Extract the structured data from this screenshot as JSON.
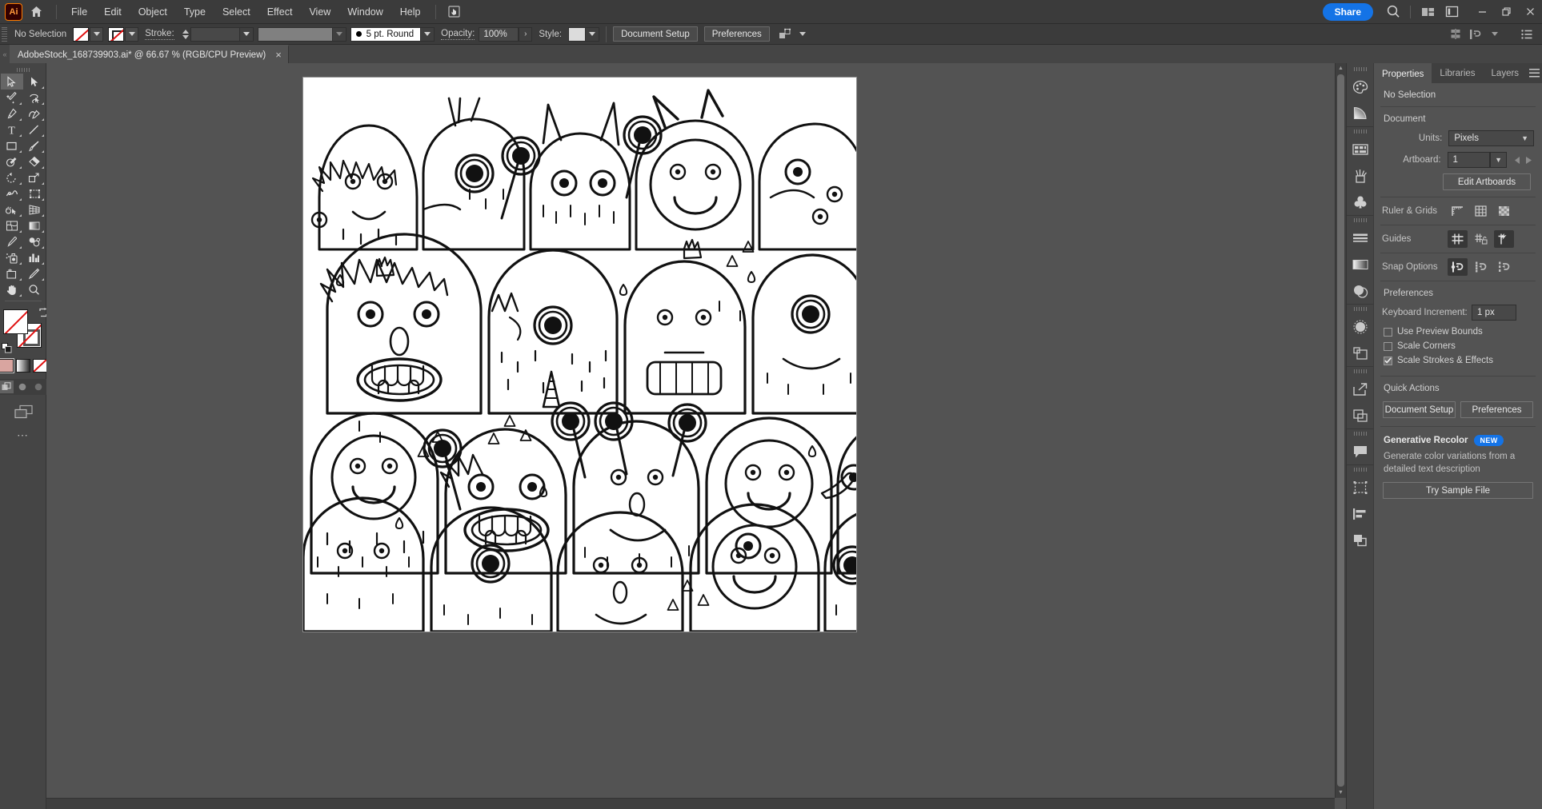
{
  "app": {
    "logo_text": "Ai",
    "menus": [
      "File",
      "Edit",
      "Object",
      "Type",
      "Select",
      "Effect",
      "View",
      "Window",
      "Help"
    ],
    "share_label": "Share"
  },
  "control_bar": {
    "selection_status": "No Selection",
    "stroke_label": "Stroke:",
    "stroke_weight": "",
    "stroke_profile": "5 pt. Round",
    "opacity_label": "Opacity:",
    "opacity_value": "100%",
    "style_label": "Style:",
    "document_setup_label": "Document Setup",
    "preferences_label": "Preferences"
  },
  "tab": {
    "title": "AdobeStock_168739903.ai* @ 66.67 % (RGB/CPU Preview)",
    "close_glyph": "×"
  },
  "tools": [
    {
      "name": "selection-tool"
    },
    {
      "name": "direct-selection-tool"
    },
    {
      "name": "magic-wand-tool"
    },
    {
      "name": "lasso-tool"
    },
    {
      "name": "pen-tool"
    },
    {
      "name": "curvature-tool"
    },
    {
      "name": "type-tool"
    },
    {
      "name": "line-segment-tool"
    },
    {
      "name": "rectangle-tool"
    },
    {
      "name": "paintbrush-tool"
    },
    {
      "name": "shaper-tool"
    },
    {
      "name": "eraser-tool"
    },
    {
      "name": "rotate-tool"
    },
    {
      "name": "scale-tool"
    },
    {
      "name": "width-tool"
    },
    {
      "name": "free-transform-tool"
    },
    {
      "name": "shape-builder-tool"
    },
    {
      "name": "perspective-grid-tool"
    },
    {
      "name": "mesh-tool"
    },
    {
      "name": "gradient-tool"
    },
    {
      "name": "eyedropper-tool"
    },
    {
      "name": "blend-tool"
    },
    {
      "name": "symbol-sprayer-tool"
    },
    {
      "name": "column-graph-tool"
    },
    {
      "name": "artboard-tool"
    },
    {
      "name": "slice-tool"
    },
    {
      "name": "hand-tool"
    },
    {
      "name": "zoom-tool"
    }
  ],
  "panel": {
    "tabs": [
      "Properties",
      "Libraries",
      "Layers"
    ],
    "active_tab": "Properties",
    "selection_text": "No Selection",
    "document": {
      "heading": "Document",
      "units_label": "Units:",
      "units_value": "Pixels",
      "artboard_label": "Artboard:",
      "artboard_value": "1",
      "edit_artboards_label": "Edit Artboards"
    },
    "ruler_grids_label": "Ruler & Grids",
    "guides_label": "Guides",
    "snap_options_label": "Snap Options",
    "preferences_heading": "Preferences",
    "keyboard_increment_label": "Keyboard Increment:",
    "keyboard_increment_value": "1 px",
    "checkboxes": [
      {
        "label": "Use Preview Bounds",
        "checked": false
      },
      {
        "label": "Scale Corners",
        "checked": false
      },
      {
        "label": "Scale Strokes & Effects",
        "checked": true
      }
    ],
    "quick_actions_heading": "Quick Actions",
    "quick_document_setup": "Document Setup",
    "quick_preferences": "Preferences",
    "generative_recolor": {
      "title": "Generative Recolor",
      "badge": "NEW",
      "description": "Generate color variations from a detailed text description",
      "button": "Try Sample File"
    }
  },
  "colors": {
    "accent_blue": "#1473e6",
    "panel_bg": "#535353",
    "chrome_bg": "#3b3b3b",
    "toolbar_bg": "#454545",
    "none_red": "#e01010",
    "canvas_white": "#ffffff"
  },
  "canvas": {
    "artwork_description": "Black and white doodle pattern of cartoon monsters"
  }
}
